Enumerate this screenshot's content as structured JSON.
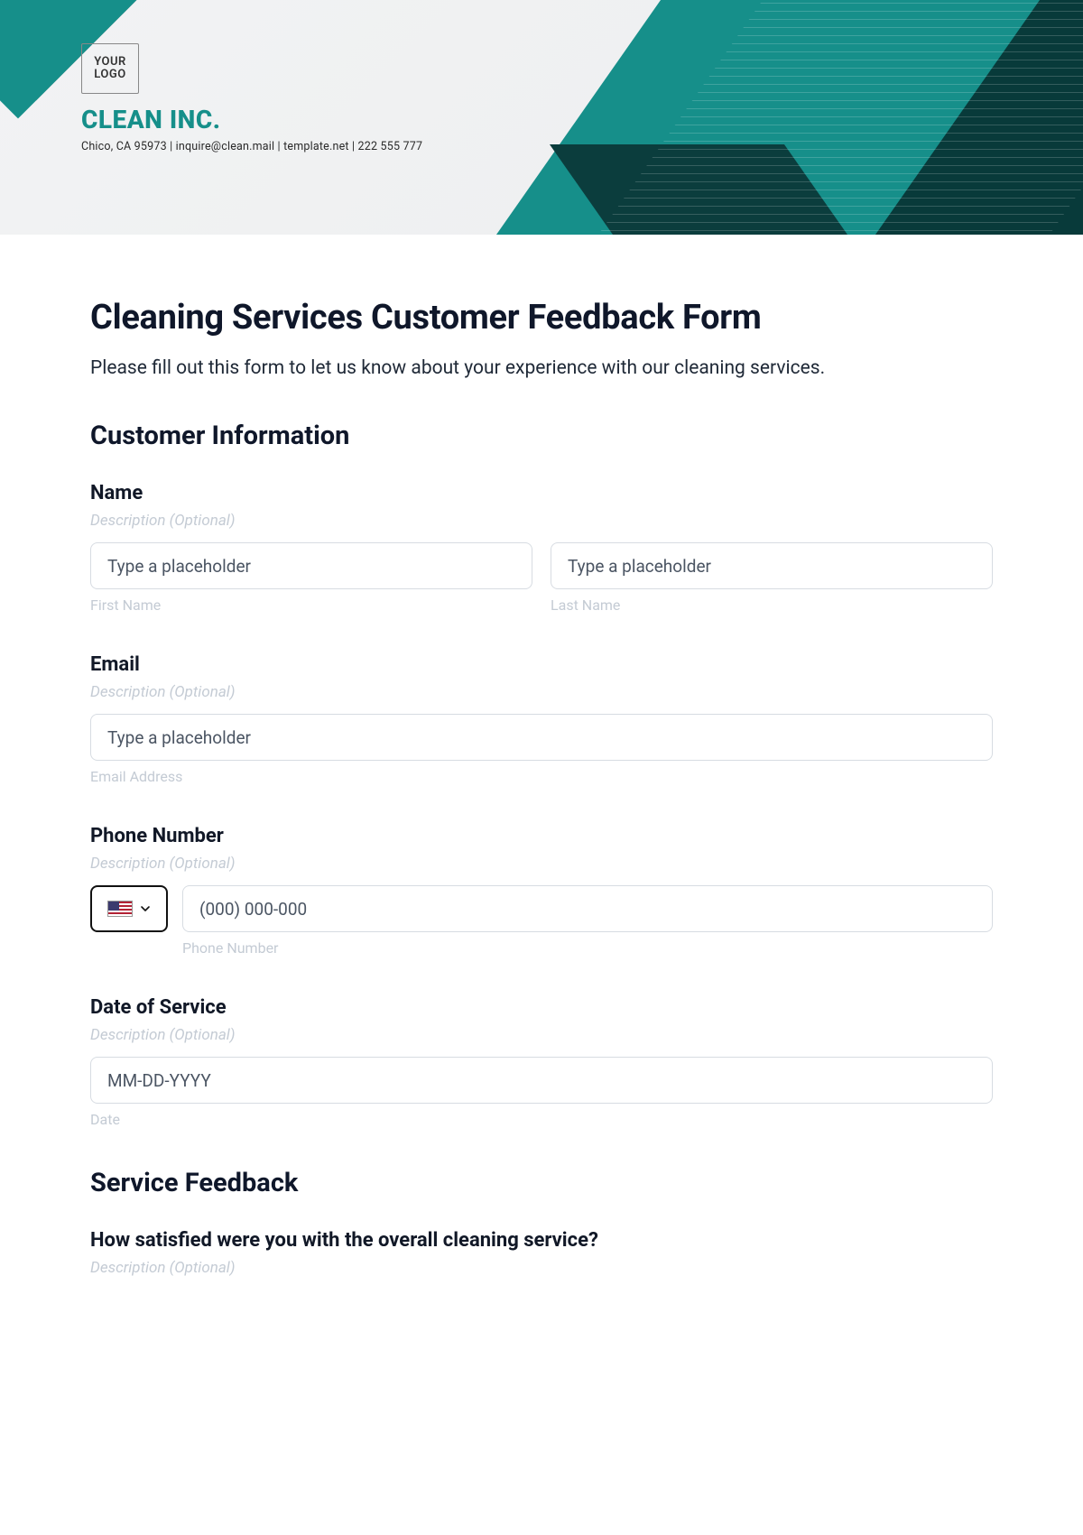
{
  "brand": {
    "logo_text": "YOUR\nLOGO",
    "name": "CLEAN INC.",
    "meta": "Chico, CA 95973 | inquire@clean.mail | template.net | 222 555 777"
  },
  "form": {
    "title": "Cleaning Services Customer Feedback Form",
    "intro": "Please fill out this form to let us know about your experience with our cleaning services."
  },
  "sections": {
    "customer_info": "Customer Information",
    "service_feedback": "Service Feedback"
  },
  "fields": {
    "name": {
      "label": "Name",
      "desc": "Description (Optional)",
      "first_placeholder": "Type a placeholder",
      "last_placeholder": "Type a placeholder",
      "first_sub": "First Name",
      "last_sub": "Last Name"
    },
    "email": {
      "label": "Email",
      "desc": "Description (Optional)",
      "placeholder": "Type a placeholder",
      "sub": "Email Address"
    },
    "phone": {
      "label": "Phone Number",
      "desc": "Description (Optional)",
      "country": "US",
      "placeholder": "(000) 000-000",
      "sub": "Phone Number"
    },
    "date": {
      "label": "Date of Service",
      "desc": "Description (Optional)",
      "placeholder": "MM-DD-YYYY",
      "sub": "Date"
    },
    "satisfaction": {
      "label": "How satisfied were you with the overall cleaning service?",
      "desc": "Description (Optional)"
    }
  }
}
